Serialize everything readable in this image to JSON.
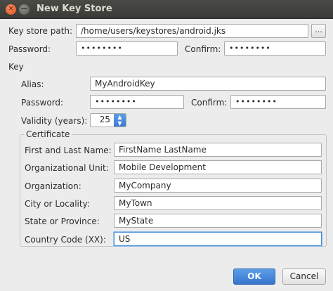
{
  "window": {
    "title": "New Key Store",
    "close_glyph": "✕",
    "minimize_glyph": "—"
  },
  "keystore": {
    "path_label": "Key store path:",
    "path_value": "/home/users/keystores/android.jks",
    "browse_label": "...",
    "password_label": "Password:",
    "password_value": "••••••••",
    "confirm_label": "Confirm:",
    "confirm_value": "••••••••"
  },
  "key": {
    "section_label": "Key",
    "alias_label": "Alias:",
    "alias_value": "MyAndroidKey",
    "password_label": "Password:",
    "password_value": "••••••••",
    "confirm_label": "Confirm:",
    "confirm_value": "••••••••",
    "validity_label": "Validity (years):",
    "validity_value": "25",
    "spin_up": "▲",
    "spin_down": "▼"
  },
  "certificate": {
    "group_label": "Certificate",
    "fields": [
      {
        "label": "First and Last Name:",
        "value": "FirstName LastName"
      },
      {
        "label": "Organizational Unit:",
        "value": "Mobile Development"
      },
      {
        "label": "Organization:",
        "value": "MyCompany"
      },
      {
        "label": "City or Locality:",
        "value": "MyTown"
      },
      {
        "label": "State or Province:",
        "value": "MyState"
      },
      {
        "label": "Country Code (XX):",
        "value": "US"
      }
    ]
  },
  "buttons": {
    "ok": "OK",
    "cancel": "Cancel"
  },
  "icons": {
    "close": "close-icon",
    "minimize": "minimize-icon",
    "spin_up": "chevron-up-icon",
    "spin_down": "chevron-down-icon"
  },
  "colors": {
    "accent": "#4a90d9",
    "titlebar": "#3c3c39",
    "close_button": "#e0531e"
  }
}
